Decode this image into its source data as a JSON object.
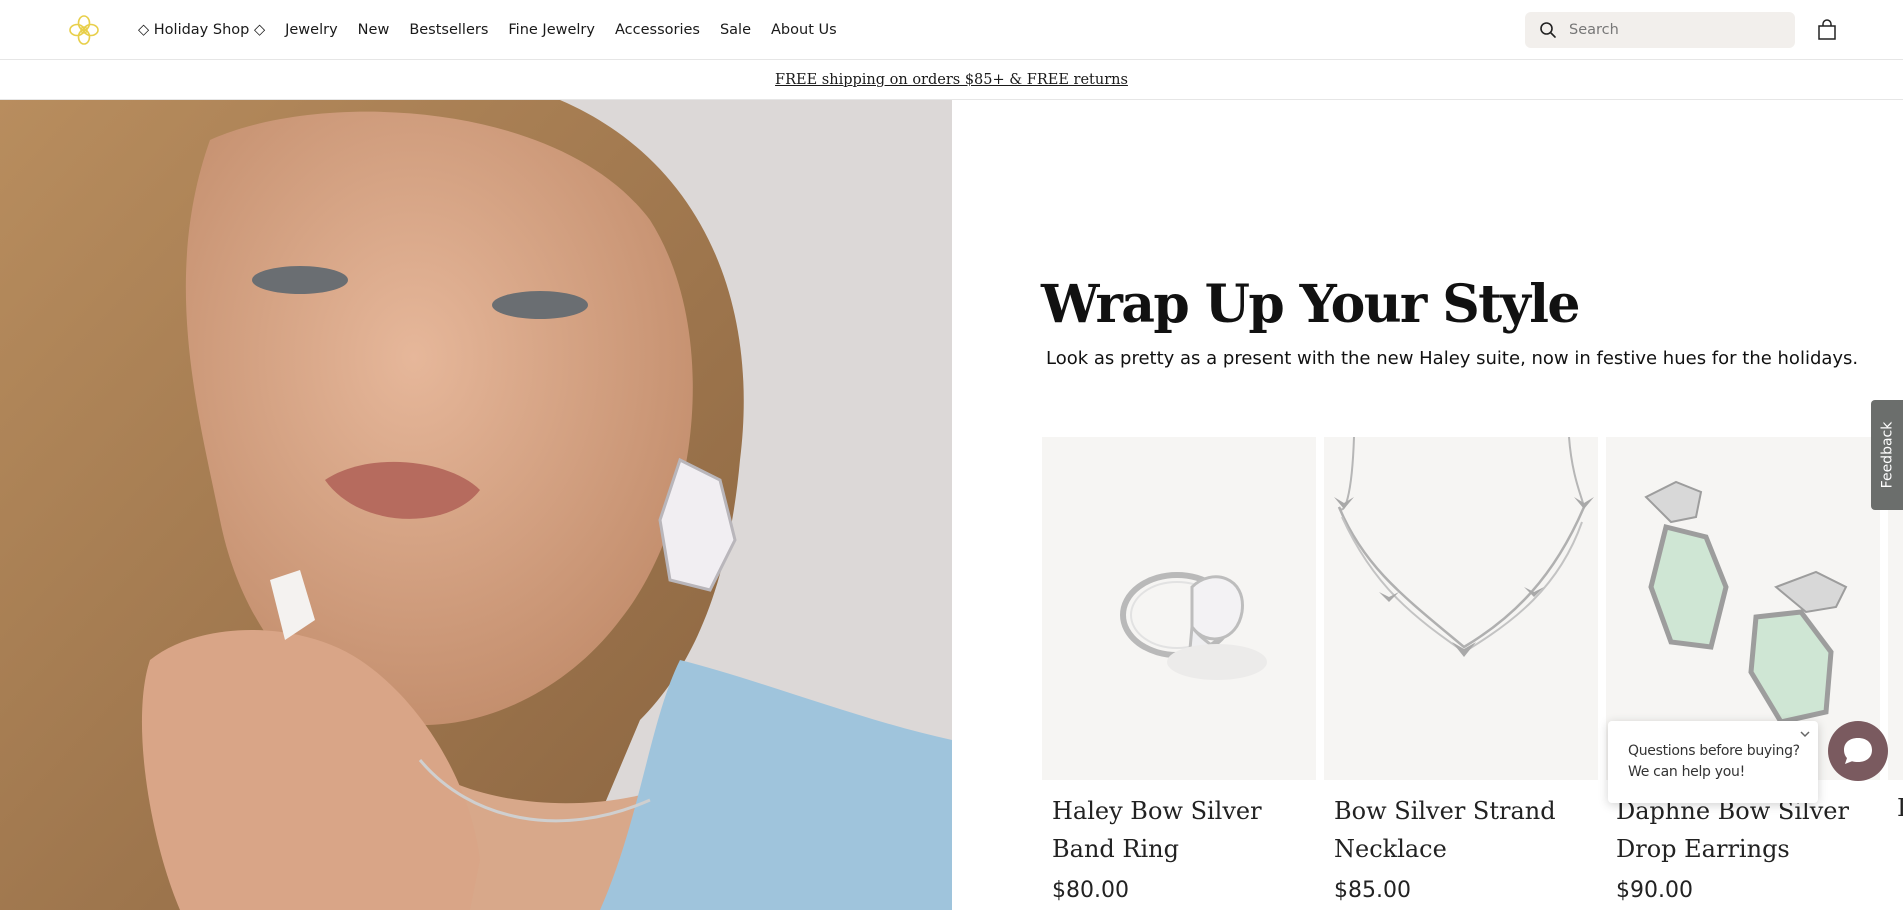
{
  "header": {
    "nav": [
      "◇ Holiday Shop ◇",
      "Jewelry",
      "New",
      "Bestsellers",
      "Fine Jewelry",
      "Accessories",
      "Sale",
      "About Us"
    ],
    "search_placeholder": "Search",
    "icons": {
      "logo": "kendra-flower-logo",
      "search": "search-icon",
      "bag": "shopping-bag-icon"
    },
    "logo_color": "#e8cf4a"
  },
  "promo": {
    "text": "FREE shipping on orders $85+ & FREE returns"
  },
  "hero": {
    "image": "model-wearing-haley-bow-jewelry"
  },
  "main": {
    "headline": "Wrap Up Your Style",
    "subhead": "Look as pretty as a present with the new Haley suite, now in festive hues for the holidays.",
    "products": [
      {
        "name": "Haley Bow Silver Band Ring",
        "price": "$80.00",
        "image": "ring-with-bow"
      },
      {
        "name": "Bow Silver Strand Necklace",
        "price": "$85.00",
        "image": "necklace-with-bows"
      },
      {
        "name": "Daphne Bow Silver Drop Earrings",
        "price": "$90.00",
        "image": "drop-earrings-with-bows"
      }
    ],
    "partial_card": {
      "letter": "I"
    }
  },
  "feedback": {
    "label": "Feedback"
  },
  "chat": {
    "line1": "Questions before buying?",
    "line2": "We can help you!",
    "button_color": "#7a5a5f"
  }
}
